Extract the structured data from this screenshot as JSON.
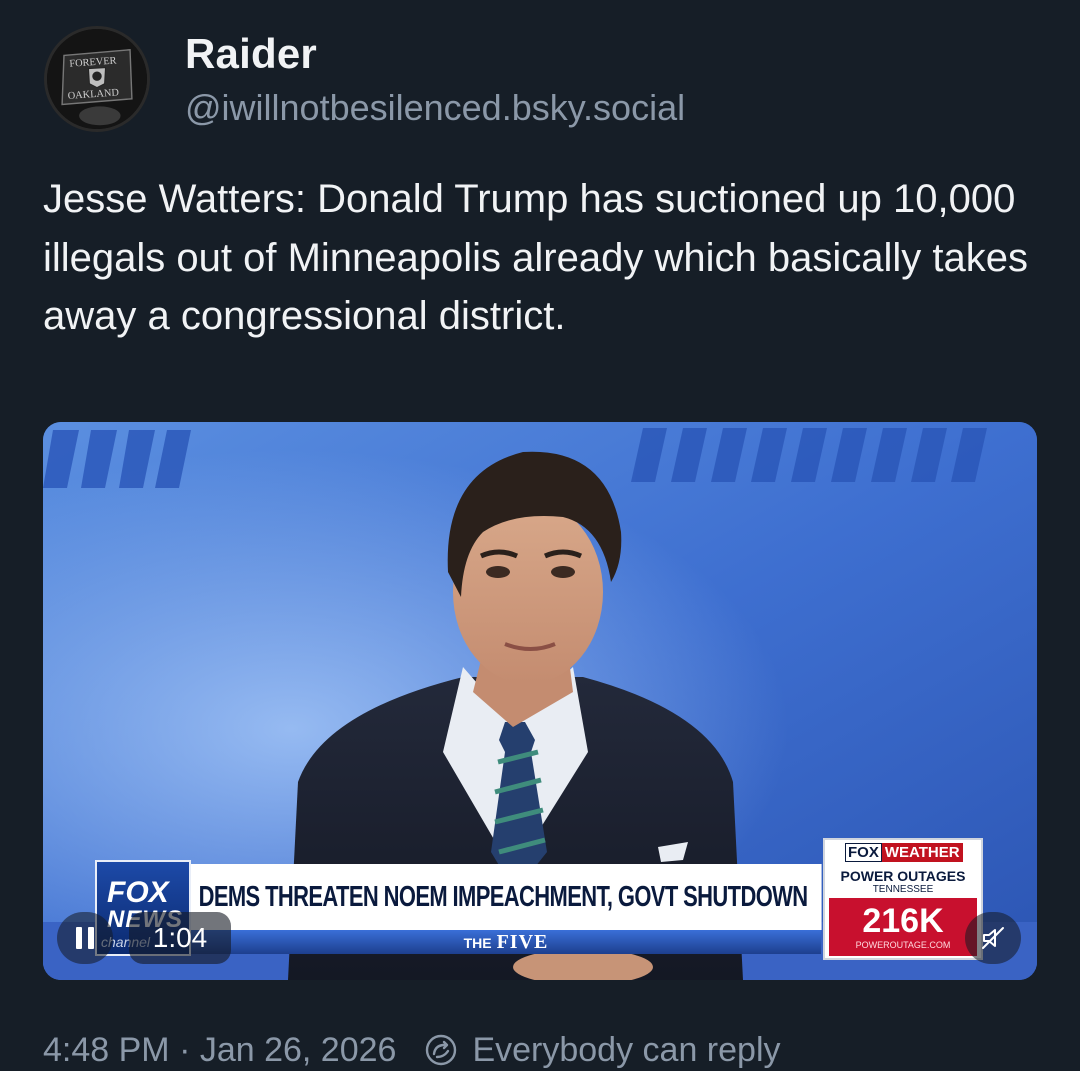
{
  "author": {
    "display_name": "Raider",
    "handle": "@iwillnotbesilenced.bsky.social",
    "avatar_text_top": "FOREVER",
    "avatar_text_bottom": "OAKLAND"
  },
  "post": {
    "text": "Jesse Watters: Donald Trump has suctioned up 10,000 illegals out of Minneapolis already which basically takes away a congressional district."
  },
  "video": {
    "chyron": {
      "network_fox": "FOX",
      "network_news": "NEWS",
      "network_channel": "channel",
      "headline": "DEMS THREATEN NOEM IMPEACHMENT, GOVT SHUTDOWN",
      "show_prefix": "THE",
      "show_name": "FIVE"
    },
    "weather": {
      "brand_fox": "FOX",
      "brand_weather": "WEATHER",
      "title": "POWER OUTAGES",
      "state": "TENNESSEE",
      "count": "216K",
      "source": "POWEROUTAGE.COM"
    },
    "player": {
      "time": "1:04"
    }
  },
  "footer": {
    "timestamp": "4:48 PM · Jan 26, 2026",
    "reply_setting": "Everybody can reply"
  },
  "colors": {
    "background": "#161e27",
    "text": "#f1f3f5",
    "muted": "#8b98a8",
    "fox_red": "#c8102e"
  }
}
